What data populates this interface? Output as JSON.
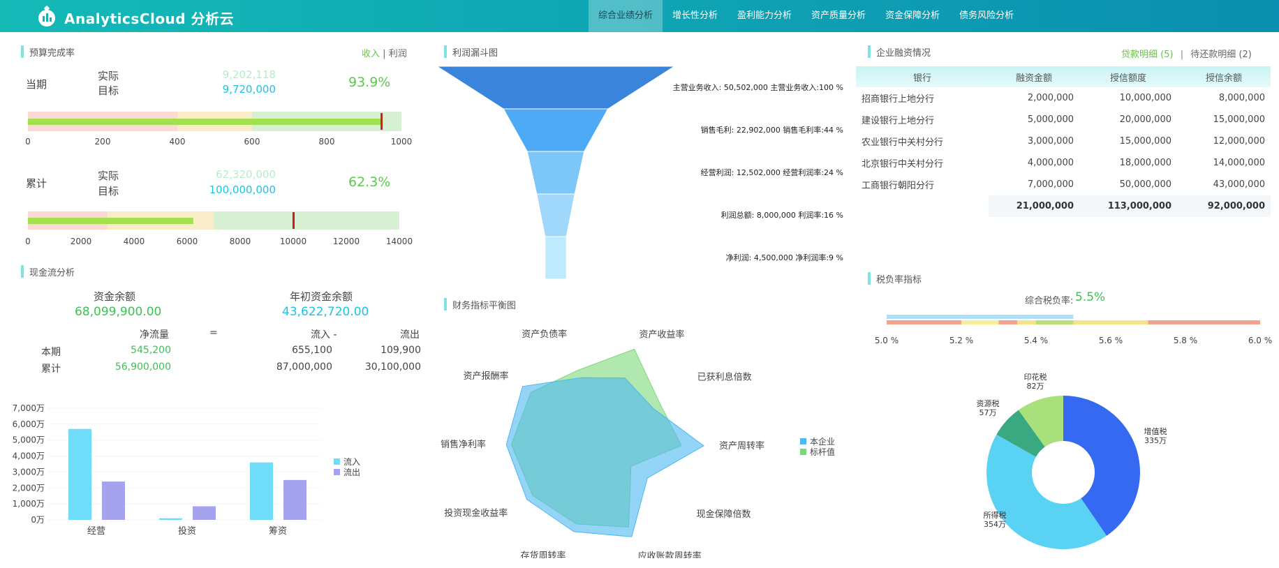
{
  "app": {
    "title": "AnalyticsCloud 分析云",
    "nav": [
      "综合业绩分析",
      "增长性分析",
      "盈利能力分析",
      "资产质量分析",
      "资金保障分析",
      "债务风险分析"
    ]
  },
  "budget": {
    "title": "预算完成率",
    "toggle": {
      "income": "收入",
      "sep": "|",
      "profit": "利润"
    },
    "current": {
      "period": "当期",
      "actual_label": "实际",
      "target_label": "目标",
      "actual": "9,202,118",
      "target": "9,720,000",
      "pct": "93.9%",
      "ticks": [
        "0",
        "200",
        "400",
        "600",
        "800",
        "1000"
      ],
      "bar_value": 946,
      "marker": 946,
      "axis_max": 1000,
      "band_edges": [
        400,
        600
      ]
    },
    "cumulative": {
      "period": "累计",
      "actual_label": "实际",
      "target_label": "目标",
      "actual": "62,320,000",
      "target": "100,000,000",
      "pct": "62.3%",
      "ticks": [
        "0",
        "2000",
        "4000",
        "6000",
        "8000",
        "10000",
        "12000",
        "14000"
      ],
      "bar_value": 6232,
      "marker": 10000,
      "axis_max": 14000,
      "band_edges": [
        3000,
        7000
      ]
    }
  },
  "cashflow": {
    "title": "现金流分析",
    "balance_label": "资金余额",
    "balance": "68,099,900.00",
    "begin_label": "年初资金余额",
    "begin": "43,622,720.00",
    "headers": {
      "net": "净流量",
      "eq": "=",
      "in": "流入 -",
      "out": "流出"
    },
    "rows": [
      {
        "label": "本期",
        "net": "545,200",
        "in": "655,100",
        "out": "109,900"
      },
      {
        "label": "累计",
        "net": "56,900,000",
        "in": "87,000,000",
        "out": "30,100,000"
      }
    ]
  },
  "chart_data": [
    {
      "type": "bar",
      "categories": [
        "经营",
        "投资",
        "筹资"
      ],
      "series": [
        {
          "name": "流入",
          "values": [
            5700,
            100,
            3600
          ],
          "color": "#6fdcfa"
        },
        {
          "name": "流出",
          "values": [
            2400,
            850,
            2500
          ],
          "color": "#a5a2ee"
        }
      ],
      "ytick_labels": [
        "0万",
        "1,000万",
        "2,000万",
        "3,000万",
        "4,000万",
        "5,000万",
        "6,000万",
        "7,000万"
      ],
      "ylim": [
        0,
        7000
      ],
      "legend": "right"
    },
    {
      "type": "funnel",
      "title": "利润漏斗图",
      "items": [
        {
          "label": "主营业务收入: 50,502,000 主营业务收入:100 %",
          "value": 100,
          "color": "#3a84dc"
        },
        {
          "label": "销售毛利: 22,902,000 销售毛利率:44 %",
          "value": 44,
          "color": "#4eaaf5"
        },
        {
          "label": "经营利润: 12,502,000 经营利润率:24 %",
          "value": 24,
          "color": "#7cc6f8"
        },
        {
          "label": "利润总额: 8,000,000 利润率:16 %",
          "value": 16,
          "color": "#9fd8fa"
        },
        {
          "label": "净利润: 4,500,000 净利润率:9 %",
          "value": 9,
          "color": "#bfe9fc"
        }
      ]
    },
    {
      "type": "radar",
      "title": "财务指标平衡图",
      "axes": [
        "资产收益率",
        "已获利息倍数",
        "资产周转率",
        "现金保障倍数",
        "应收账款周转率",
        "存货周转率",
        "投资现金收益率",
        "销售净利率",
        "资产报酬率",
        "资产负债率"
      ],
      "series": [
        {
          "name": "本企业",
          "values": [
            0.7,
            0.62,
            1.0,
            0.55,
            0.95,
            0.9,
            0.92,
            0.95,
            0.98,
            0.7
          ],
          "color": "#4db8f2"
        },
        {
          "name": "标杆值",
          "values": [
            1.0,
            0.7,
            0.78,
            0.35,
            0.85,
            0.82,
            0.85,
            0.9,
            0.88,
            0.78
          ],
          "color": "#7dd87a"
        }
      ]
    },
    {
      "type": "bar",
      "title": "综合税负率",
      "value_label": "5.5%",
      "value": 5.5,
      "xlim": [
        5.0,
        6.0
      ],
      "tick_labels": [
        "5.0 %",
        "5.2 %",
        "5.4 %",
        "5.6 %",
        "5.8 %",
        "6.0 %"
      ]
    },
    {
      "type": "pie",
      "title": "税负率指标",
      "slices": [
        {
          "name": "增值税",
          "value": 335,
          "label": "335万",
          "color": "#3569f2"
        },
        {
          "name": "所得税",
          "value": 354,
          "label": "354万",
          "color": "#5ad2f4"
        },
        {
          "name": "资源税",
          "value": 57,
          "label": "57万",
          "color": "#3aa981"
        },
        {
          "name": "印花税",
          "value": 82,
          "label": "82万",
          "color": "#a8e07c"
        }
      ]
    }
  ],
  "financing": {
    "title": "企业融资情况",
    "loan_detail": "贷款明细",
    "loan_count": "(5)",
    "sep": "|",
    "repay_detail": "待还款明细",
    "repay_count": "(2)",
    "headers": [
      "银行",
      "融资金额",
      "授信额度",
      "授信余额"
    ],
    "rows": [
      [
        "招商银行上地分行",
        "2,000,000",
        "10,000,000",
        "8,000,000"
      ],
      [
        "建设银行上地分行",
        "5,000,000",
        "20,000,000",
        "15,000,000"
      ],
      [
        "农业银行中关村分行",
        "3,000,000",
        "15,000,000",
        "12,000,000"
      ],
      [
        "北京银行中关村分行",
        "4,000,000",
        "18,000,000",
        "14,000,000"
      ],
      [
        "工商银行朝阳分行",
        "7,000,000",
        "50,000,000",
        "43,000,000"
      ]
    ],
    "totals": [
      "21,000,000",
      "113,000,000",
      "92,000,000"
    ]
  },
  "tax": {
    "title": "税负率指标",
    "rate_label": "综合税负率:"
  }
}
